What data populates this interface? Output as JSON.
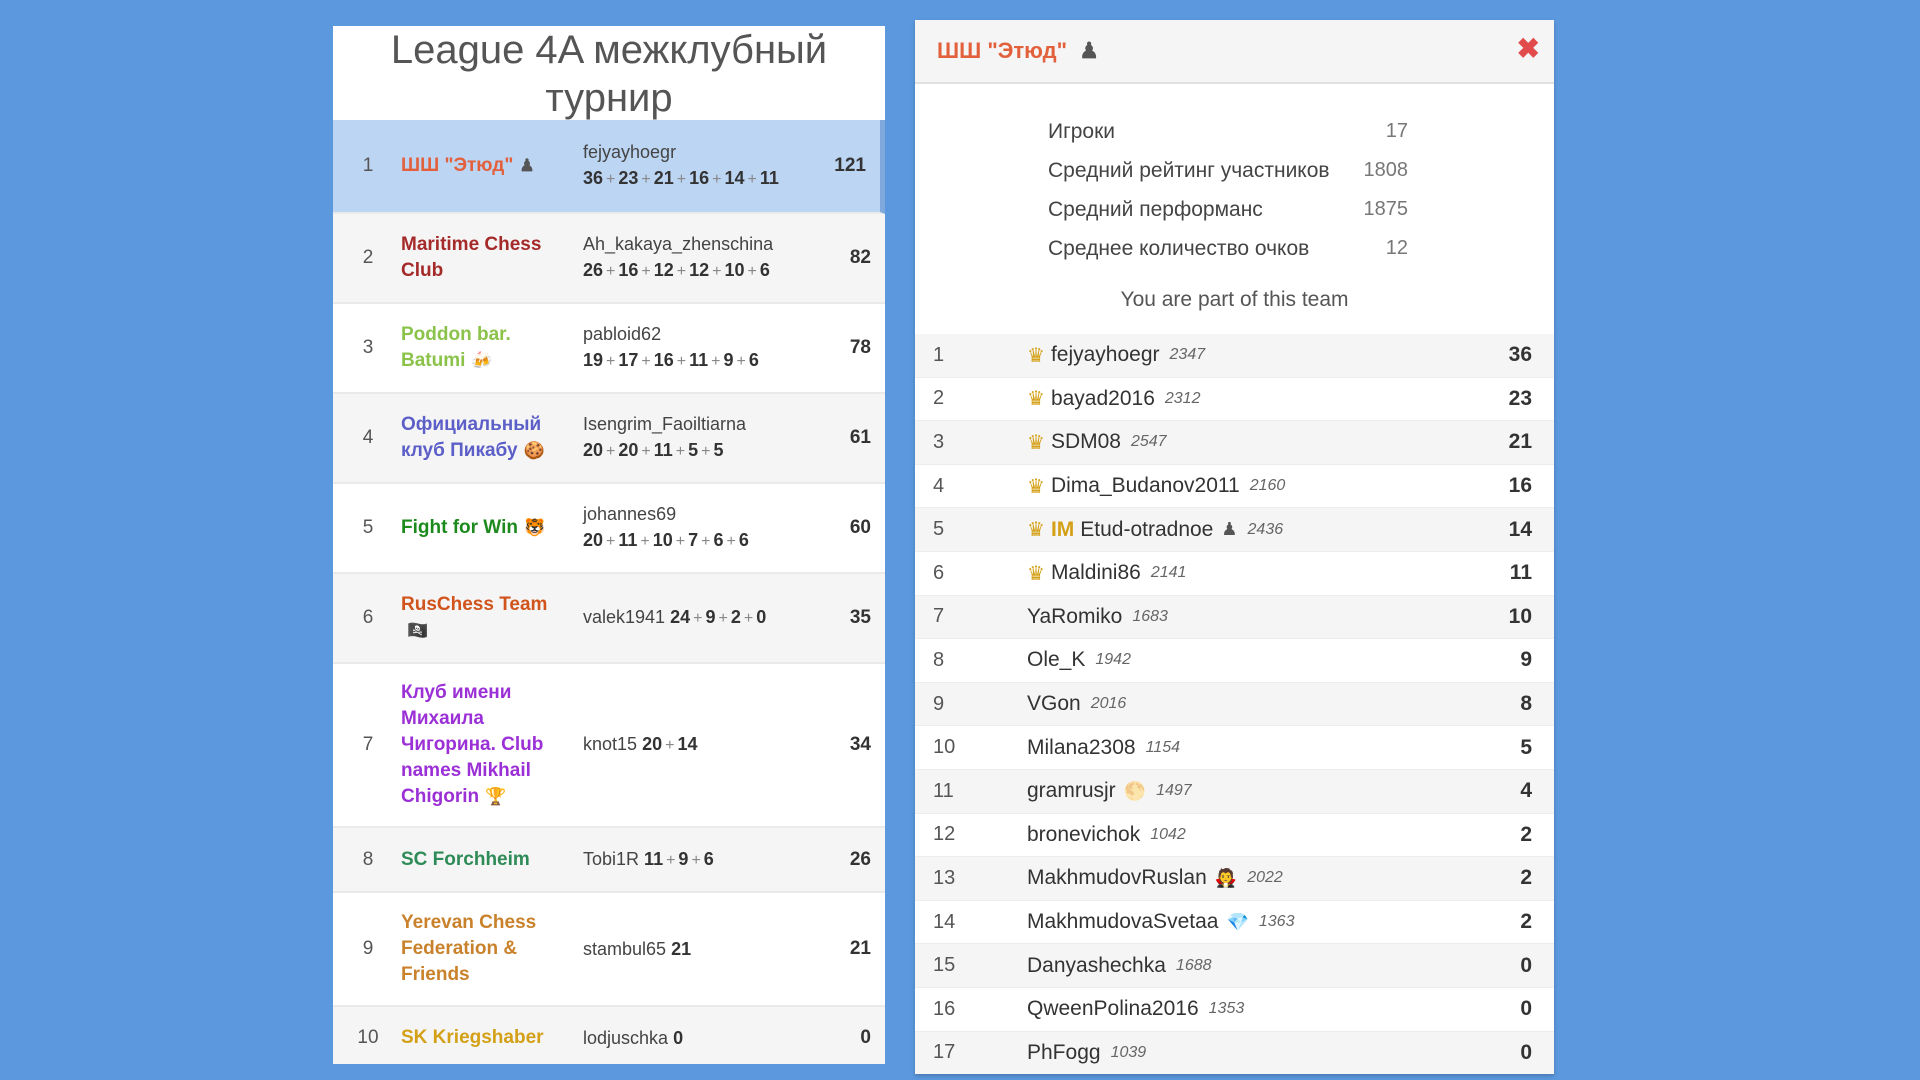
{
  "league": {
    "title": "League 4A межклубный турнир",
    "rows": [
      {
        "rank": "1",
        "team": "ШШ \"Этюд\"",
        "icon": "♟",
        "color": "#e2603b",
        "players": [
          [
            "fejyayhoegr",
            "36"
          ],
          [
            "",
            "23"
          ],
          [
            "",
            "21"
          ],
          [
            "",
            "16"
          ],
          [
            "",
            "14"
          ],
          [
            "",
            "11"
          ]
        ],
        "score": "121",
        "highlight": true
      },
      {
        "rank": "2",
        "team": "Maritime Chess Club",
        "icon": "",
        "color": "#a52a2a",
        "players": [
          [
            "Ah_kakaya_zhenschina",
            "26"
          ],
          [
            "",
            "16"
          ],
          [
            "",
            "12"
          ],
          [
            "",
            "12"
          ],
          [
            "",
            "10"
          ],
          [
            "",
            "6"
          ]
        ],
        "score": "82"
      },
      {
        "rank": "3",
        "team": "Poddon bar. Batumi",
        "icon": "🍻",
        "color": "#8bc34a",
        "players": [
          [
            "pabloid62",
            "19"
          ],
          [
            "",
            "17"
          ],
          [
            "",
            "16"
          ],
          [
            "",
            "11"
          ],
          [
            "",
            "9"
          ],
          [
            "",
            "6"
          ]
        ],
        "score": "78"
      },
      {
        "rank": "4",
        "team": "Официальный клуб Пикабу",
        "icon": "🍪",
        "color": "#5b5fc7",
        "players": [
          [
            "Isengrim_Faoiltiarna",
            "20"
          ],
          [
            "",
            "20"
          ],
          [
            "",
            "11"
          ],
          [
            "",
            "5"
          ],
          [
            "",
            "5"
          ]
        ],
        "score": "61"
      },
      {
        "rank": "5",
        "team": "Fight for Win",
        "icon": "🐯",
        "color": "#1d8a1d",
        "players": [
          [
            "johannes69",
            "20"
          ],
          [
            "",
            "11"
          ],
          [
            "",
            "10"
          ],
          [
            "",
            "7"
          ],
          [
            "",
            "6"
          ],
          [
            "",
            "6"
          ]
        ],
        "score": "60"
      },
      {
        "rank": "6",
        "team": "RusChess Team",
        "icon": "🏴‍☠️",
        "color": "#d0541b",
        "players": [
          [
            "valek1941",
            "24"
          ],
          [
            "",
            "9"
          ],
          [
            "",
            "2"
          ],
          [
            "",
            "0"
          ]
        ],
        "score": "35"
      },
      {
        "rank": "7",
        "team": "Клуб имени Михаила Чигорина. Club names Mikhail Chigorin",
        "icon": "🏆",
        "color": "#9b30d6",
        "players": [
          [
            "knot15",
            "20"
          ],
          [
            "",
            "14"
          ]
        ],
        "score": "34"
      },
      {
        "rank": "8",
        "team": "SC Forchheim",
        "icon": "",
        "color": "#2e8b57",
        "players": [
          [
            "Tobi1R",
            "11"
          ],
          [
            "",
            "9"
          ],
          [
            "",
            "6"
          ]
        ],
        "score": "26"
      },
      {
        "rank": "9",
        "team": "Yerevan Chess Federation & Friends",
        "icon": "",
        "color": "#c9822b",
        "players": [
          [
            "stambul65",
            "21"
          ]
        ],
        "score": "21"
      },
      {
        "rank": "10",
        "team": "SK Kriegshaber",
        "icon": "",
        "color": "#d4a017",
        "players": [
          [
            "lodjuschka",
            "0"
          ]
        ],
        "score": "0"
      }
    ]
  },
  "team_panel": {
    "title": "ШШ \"Этюд\"",
    "title_icon": "♟",
    "close": "✖",
    "stats": [
      {
        "label": "Игроки",
        "value": "17"
      },
      {
        "label": "Средний рейтинг участников",
        "value": "1808"
      },
      {
        "label": "Средний перформанс",
        "value": "1875"
      },
      {
        "label": "Среднее количество очков",
        "value": "12"
      }
    ],
    "member_note": "You are part of this team",
    "players": [
      {
        "rank": "1",
        "crown": true,
        "title": "",
        "name": "fejyayhoegr",
        "badge": "",
        "rating": "2347",
        "score": "36"
      },
      {
        "rank": "2",
        "crown": true,
        "title": "",
        "name": "bayad2016",
        "badge": "",
        "rating": "2312",
        "score": "23"
      },
      {
        "rank": "3",
        "crown": true,
        "title": "",
        "name": "SDM08",
        "badge": "",
        "rating": "2547",
        "score": "21"
      },
      {
        "rank": "4",
        "crown": true,
        "title": "",
        "name": "Dima_Budanov2011",
        "badge": "",
        "rating": "2160",
        "score": "16"
      },
      {
        "rank": "5",
        "crown": true,
        "title": "IM",
        "name": "Etud-otradnoe",
        "badge": "♟",
        "rating": "2436",
        "score": "14"
      },
      {
        "rank": "6",
        "crown": true,
        "title": "",
        "name": "Maldini86",
        "badge": "",
        "rating": "2141",
        "score": "11"
      },
      {
        "rank": "7",
        "crown": false,
        "title": "",
        "name": "YaRomiko",
        "badge": "",
        "rating": "1683",
        "score": "10"
      },
      {
        "rank": "8",
        "crown": false,
        "title": "",
        "name": "Ole_K",
        "badge": "",
        "rating": "1942",
        "score": "9"
      },
      {
        "rank": "9",
        "crown": false,
        "title": "",
        "name": "VGon",
        "badge": "",
        "rating": "2016",
        "score": "8"
      },
      {
        "rank": "10",
        "crown": false,
        "title": "",
        "name": "Milana2308",
        "badge": "",
        "rating": "1154",
        "score": "5"
      },
      {
        "rank": "11",
        "crown": false,
        "title": "",
        "name": "gramrusjr",
        "badge": "🌕",
        "rating": "1497",
        "score": "4"
      },
      {
        "rank": "12",
        "crown": false,
        "title": "",
        "name": "bronevichok",
        "badge": "",
        "rating": "1042",
        "score": "2"
      },
      {
        "rank": "13",
        "crown": false,
        "title": "",
        "name": "MakhmudovRuslan",
        "badge": "🧛",
        "rating": "2022",
        "score": "2"
      },
      {
        "rank": "14",
        "crown": false,
        "title": "",
        "name": "MakhmudovaSvetaa",
        "badge": "💎",
        "rating": "1363",
        "score": "2"
      },
      {
        "rank": "15",
        "crown": false,
        "title": "",
        "name": "Danyashechka",
        "badge": "",
        "rating": "1688",
        "score": "0"
      },
      {
        "rank": "16",
        "crown": false,
        "title": "",
        "name": "QweenPolina2016",
        "badge": "",
        "rating": "1353",
        "score": "0"
      },
      {
        "rank": "17",
        "crown": false,
        "title": "",
        "name": "PhFogg",
        "badge": "",
        "rating": "1039",
        "score": "0"
      }
    ]
  }
}
